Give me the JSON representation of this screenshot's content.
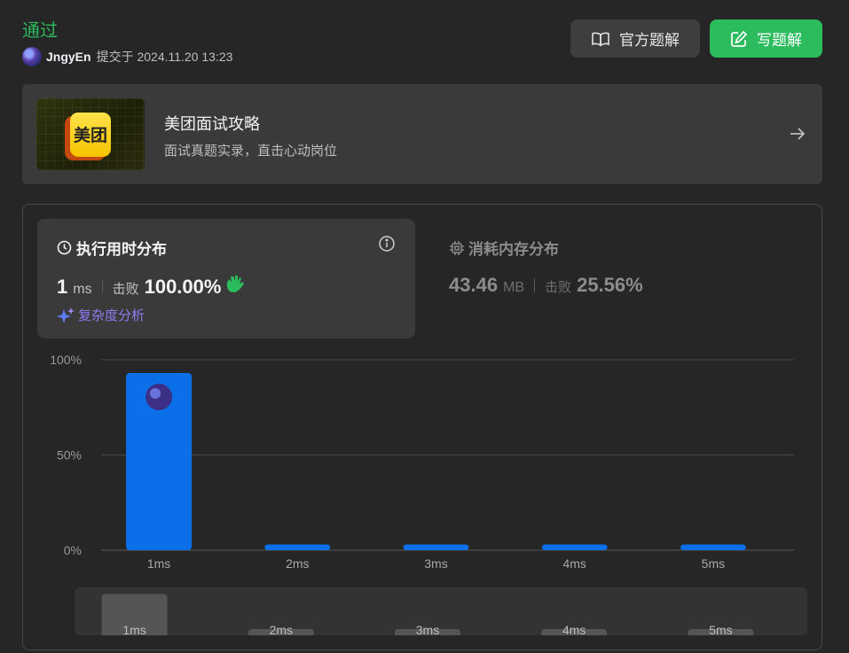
{
  "header": {
    "status": "通过",
    "username": "JngyEn",
    "submitted_label": "提交于 2024.11.20 13:23"
  },
  "buttons": {
    "official_solution": "官方题解",
    "write_solution": "写题解"
  },
  "promo": {
    "logo_text": "美团",
    "title": "美团面试攻略",
    "description": "面试真题实录，直击心动岗位"
  },
  "runtime": {
    "title": "执行用时分布",
    "value": "1",
    "unit": "ms",
    "beat_label": "击败",
    "beat_percent": "100.00%",
    "complexity_link": "复杂度分析"
  },
  "memory": {
    "title": "消耗内存分布",
    "value": "43.46",
    "unit": "MB",
    "beat_label": "击败",
    "beat_percent": "25.56%"
  },
  "colors": {
    "accent_green": "#2cbb5d",
    "bar_blue": "#0a6fe8",
    "nav_bar_gray": "#555555"
  },
  "chart_data": {
    "type": "bar",
    "categories": [
      "1ms",
      "2ms",
      "3ms",
      "4ms",
      "5ms"
    ],
    "values": [
      93,
      3,
      3,
      3,
      3
    ],
    "yticks": [
      "100%",
      "50%",
      "0%"
    ],
    "ylim": [
      0,
      100
    ],
    "highlight_category": "1ms",
    "grid": true
  },
  "navigator": {
    "categories": [
      "1ms",
      "2ms",
      "3ms",
      "4ms",
      "5ms"
    ],
    "values": [
      93,
      3,
      3,
      3,
      3
    ]
  }
}
